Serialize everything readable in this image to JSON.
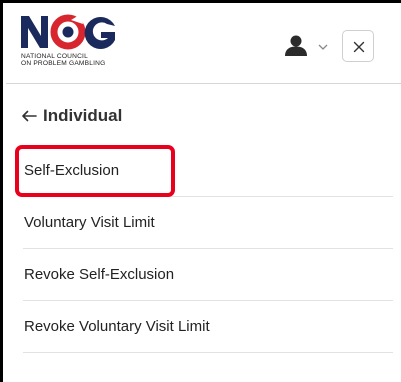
{
  "brand": {
    "logo_text": "NCG",
    "logo_sub_line1": "NATIONAL COUNCIL",
    "logo_sub_line2": "ON PROBLEM GAMBLING",
    "colors": {
      "navy": "#1b2a5c",
      "red": "#d7262e",
      "highlight": "#e8001c"
    }
  },
  "header": {
    "user_icon": "user-icon",
    "dropdown_icon": "chevron-down-icon",
    "close_label": "×"
  },
  "nav": {
    "back_label": "Individual"
  },
  "menu": {
    "items": [
      {
        "label": "Self-Exclusion",
        "highlighted": true
      },
      {
        "label": "Voluntary Visit Limit"
      },
      {
        "label": "Revoke Self-Exclusion"
      },
      {
        "label": "Revoke Voluntary Visit Limit"
      }
    ]
  }
}
